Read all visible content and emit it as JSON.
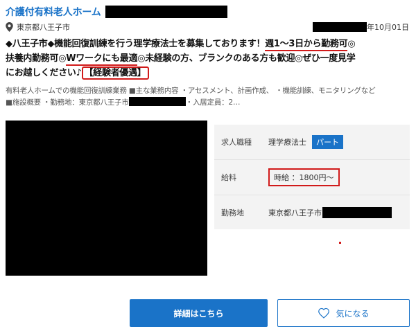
{
  "listing": {
    "title": "介護付有料老人ホーム",
    "location": "東京都八王子市",
    "date": "年10月01日",
    "headline": {
      "part1": "◆八王子市◆機能回復訓練を行う理学療法士を募集しております！",
      "emph1": "週1～3日から勤務可",
      "part2": "◎",
      "part3": "扶養内勤務可◎",
      "emph2": "Wワークにも最適",
      "part4": "◎未経験の方、ブランクのある方も歓迎◎ぜひ一度見学",
      "part5": "にお越しください♪",
      "emph3": "【経験者優遇】"
    },
    "description": {
      "line1": "有料老人ホームでの機能回復訓練業務 ■主な業務内容 ・アセスメント、計画作成、 ・機能訓練、モニタリングなど",
      "line2_a": "■施設概要 ・勤務地：東京都八王子市",
      "line2_b": "・入居定員：2…"
    },
    "info": {
      "job_label": "求人職種",
      "job_value": "理学療法士",
      "job_badge": "パート",
      "salary_label": "給料",
      "salary_value": "時給 ：1800円～",
      "place_label": "勤務地",
      "place_value": "東京都八王子市"
    },
    "buttons": {
      "detail": "詳細はこちら",
      "favorite": "気になる"
    },
    "icons": [
      "map-pin-icon",
      "heart-icon"
    ],
    "colors": {
      "accent": "#1a73c8",
      "highlight": "#d11a1a"
    }
  }
}
